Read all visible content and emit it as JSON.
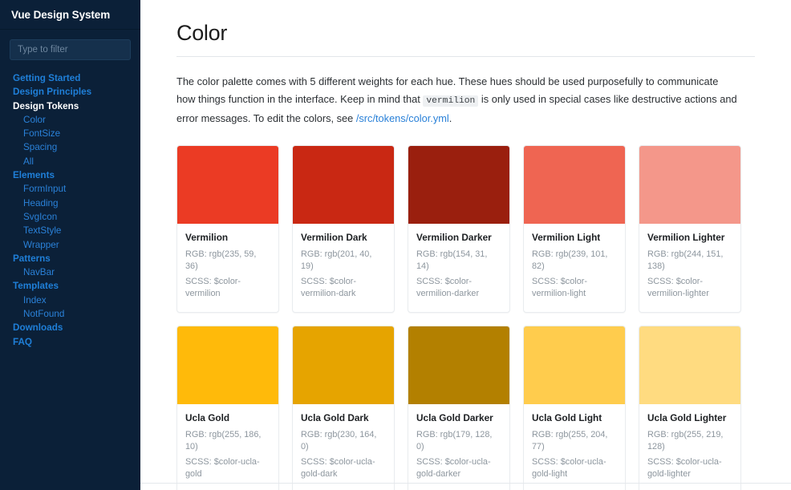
{
  "sidebar": {
    "title": "Vue Design System",
    "filter": {
      "placeholder": "Type to filter",
      "value": ""
    },
    "items": [
      {
        "label": "Getting Started",
        "level": 1,
        "active": false
      },
      {
        "label": "Design Principles",
        "level": 1,
        "active": false
      },
      {
        "label": "Design Tokens",
        "level": 1,
        "active": true
      },
      {
        "label": "Color",
        "level": 2,
        "active": false
      },
      {
        "label": "FontSize",
        "level": 2,
        "active": false
      },
      {
        "label": "Spacing",
        "level": 2,
        "active": false
      },
      {
        "label": "All",
        "level": 2,
        "active": false
      },
      {
        "label": "Elements",
        "level": 1,
        "active": false
      },
      {
        "label": "FormInput",
        "level": 2,
        "active": false
      },
      {
        "label": "Heading",
        "level": 2,
        "active": false
      },
      {
        "label": "SvgIcon",
        "level": 2,
        "active": false
      },
      {
        "label": "TextStyle",
        "level": 2,
        "active": false
      },
      {
        "label": "Wrapper",
        "level": 2,
        "active": false
      },
      {
        "label": "Patterns",
        "level": 1,
        "active": false
      },
      {
        "label": "NavBar",
        "level": 2,
        "active": false
      },
      {
        "label": "Templates",
        "level": 1,
        "active": false
      },
      {
        "label": "Index",
        "level": 2,
        "active": false
      },
      {
        "label": "NotFound",
        "level": 2,
        "active": false
      },
      {
        "label": "Downloads",
        "level": 1,
        "active": false
      },
      {
        "label": "FAQ",
        "level": 1,
        "active": false
      }
    ]
  },
  "main": {
    "title": "Color",
    "intro": {
      "part1": "The color palette comes with 5 different weights for each hue. These hues should be used purposefully to communicate how things function in the interface. Keep in mind that ",
      "code": "vermilion",
      "part2": " is only used in special cases like destructive actions and error messages. To edit the colors, see ",
      "link": "/src/tokens/color.yml",
      "part3": "."
    },
    "labels": {
      "rgb_prefix": "RGB: ",
      "scss_prefix": "SCSS: "
    },
    "colors": [
      {
        "name": "Vermilion",
        "rgb": "rgb(235, 59, 36)",
        "scss": "$color-vermilion",
        "hex": "#eb3b24"
      },
      {
        "name": "Vermilion Dark",
        "rgb": "rgb(201, 40, 19)",
        "scss": "$color-vermilion-dark",
        "hex": "#c92813"
      },
      {
        "name": "Vermilion Darker",
        "rgb": "rgb(154, 31, 14)",
        "scss": "$color-vermilion-darker",
        "hex": "#9a1f0e"
      },
      {
        "name": "Vermilion Light",
        "rgb": "rgb(239, 101, 82)",
        "scss": "$color-vermilion-light",
        "hex": "#ef6552"
      },
      {
        "name": "Vermilion Lighter",
        "rgb": "rgb(244, 151, 138)",
        "scss": "$color-vermilion-lighter",
        "hex": "#f4978a"
      },
      {
        "name": "Ucla Gold",
        "rgb": "rgb(255, 186, 10)",
        "scss": "$color-ucla-gold",
        "hex": "#ffba0a"
      },
      {
        "name": "Ucla Gold Dark",
        "rgb": "rgb(230, 164, 0)",
        "scss": "$color-ucla-gold-dark",
        "hex": "#e6a400"
      },
      {
        "name": "Ucla Gold Darker",
        "rgb": "rgb(179, 128, 0)",
        "scss": "$color-ucla-gold-darker",
        "hex": "#b38000"
      },
      {
        "name": "Ucla Gold Light",
        "rgb": "rgb(255, 204, 77)",
        "scss": "$color-ucla-gold-light",
        "hex": "#ffcc4d"
      },
      {
        "name": "Ucla Gold Lighter",
        "rgb": "rgb(255, 219, 128)",
        "scss": "$color-ucla-gold-lighter",
        "hex": "#ffdb80"
      }
    ]
  }
}
